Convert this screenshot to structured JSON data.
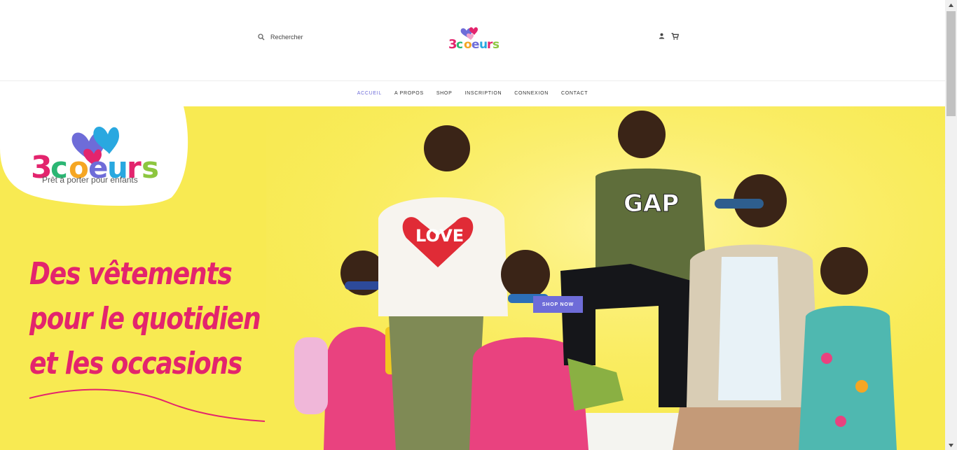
{
  "header": {
    "search_label": "Rechercher",
    "logo_text": "3coeurs",
    "icons": [
      "search-icon",
      "user-icon",
      "cart-icon"
    ]
  },
  "nav": {
    "items": [
      {
        "label": "ACCUEIL",
        "active": true
      },
      {
        "label": "A PROPOS",
        "active": false
      },
      {
        "label": "SHOP",
        "active": false
      },
      {
        "label": "INSCRIPTION",
        "active": false
      },
      {
        "label": "CONNEXION",
        "active": false
      },
      {
        "label": "CONTACT",
        "active": false
      }
    ]
  },
  "hero": {
    "logo_text": "3coeurs",
    "tagline": "Prêt à porter pour enfants",
    "headline_lines": [
      "Des vêtements",
      "pour le quotidien",
      "et les occasions"
    ],
    "shirt_text": "LOVE",
    "jacket_text": "GAP",
    "cta_label": "SHOP NOW"
  },
  "colors": {
    "accent": "#6e6cd8",
    "hero_bg": "#f8ea52",
    "headline": "#e3246d"
  }
}
